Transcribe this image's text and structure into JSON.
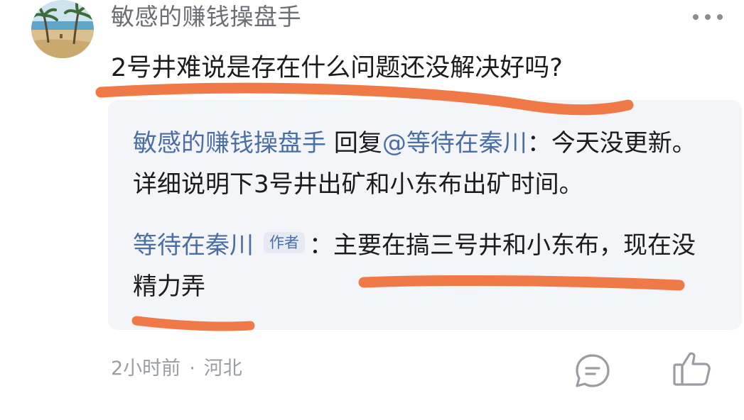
{
  "post": {
    "username": "敏感的赚钱操盘手",
    "text": "2号井难说是存在什么问题还没解决好吗?"
  },
  "replies": [
    {
      "from": "敏感的赚钱操盘手",
      "action": "回复",
      "to": "@等待在秦川",
      "separator": "：",
      "text": "今天没更新。详细说明下3号井出矿和小东布出矿时间。"
    },
    {
      "from": "等待在秦川",
      "badge": "作者",
      "separator": "：",
      "text": "主要在搞三号井和小东布，现在没精力弄"
    }
  ],
  "footer": {
    "time": "2小时前",
    "dot": "·",
    "location": "河北"
  },
  "icons": {
    "more": "more-horizontal-icon",
    "reply": "comment-bubble-icon",
    "like": "thumbs-up-icon"
  },
  "colors": {
    "username": "#6b6e75",
    "link": "#4a6fa5",
    "reply_bg": "#f4f5f8",
    "annotation": "#f07a47"
  }
}
